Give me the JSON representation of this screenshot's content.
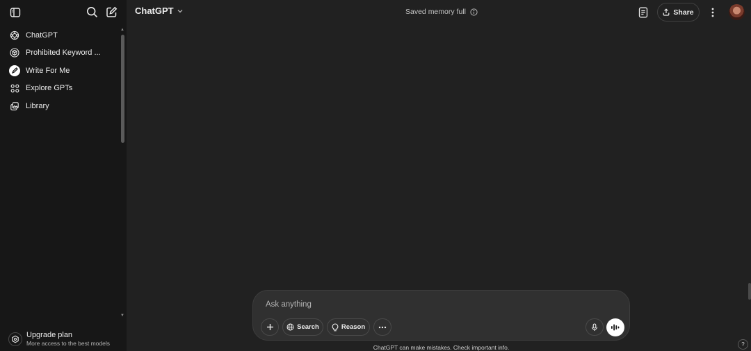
{
  "sidebar": {
    "items": [
      {
        "label": "ChatGPT",
        "icon": "openai-logo-icon"
      },
      {
        "label": "Prohibited Keyword ...",
        "icon": "cube-icon"
      },
      {
        "label": "Write For Me",
        "icon": "pen-icon"
      },
      {
        "label": "Explore GPTs",
        "icon": "grid-icon"
      },
      {
        "label": "Library",
        "icon": "images-icon"
      }
    ],
    "upgrade": {
      "title": "Upgrade plan",
      "subtitle": "More access to the best models"
    }
  },
  "header": {
    "model": "ChatGPT",
    "memory_status": "Saved memory full",
    "share_label": "Share"
  },
  "composer": {
    "placeholder": "Ask anything",
    "search_label": "Search",
    "reason_label": "Reason"
  },
  "footer": {
    "disclaimer": "ChatGPT can make mistakes. Check important info.",
    "help": "?"
  },
  "colors": {
    "background": "#212121",
    "sidebar": "#171717",
    "composer": "#303030"
  }
}
